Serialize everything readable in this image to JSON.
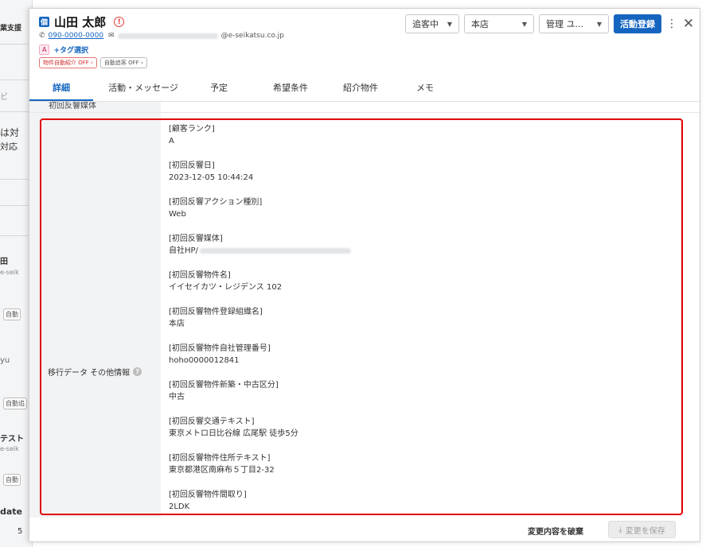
{
  "background": {
    "fragments": [
      "業支援",
      "ビ",
      "は対",
      "対応",
      "田",
      "e-seik",
      "自動",
      "yu",
      "自動追",
      "テスト",
      "e-seik",
      "自動",
      "date",
      "5"
    ]
  },
  "customer": {
    "name_badge": "個",
    "name": "山田 太郎",
    "phone": "090-0000-0000",
    "email_domain": "@e-seikatsu.co.jp",
    "tag_rank": "A",
    "tag_add_label": "+タグ選択",
    "pill_auto_intro": "物件自動紹介 OFF",
    "pill_auto_follow": "自動追客 OFF"
  },
  "header": {
    "status_value": "追客中",
    "branch_value": "本店",
    "manager_value": "管理 ユ...",
    "activity_button": "活動登録"
  },
  "tabs": [
    {
      "label": "詳細",
      "active": true
    },
    {
      "label": "活動・メッセージ",
      "active": false
    },
    {
      "label": "予定",
      "active": false
    },
    {
      "label": "希望条件",
      "active": false
    },
    {
      "label": "紹介物件",
      "active": false
    },
    {
      "label": "メモ",
      "active": false
    }
  ],
  "detail": {
    "previous_field_label": "初回反響媒体",
    "field_label": "移行データ その他情報",
    "items": [
      {
        "key": "[顧客ランク]",
        "value": "A"
      },
      {
        "key": "[初回反響日]",
        "value": "2023-12-05 10:44:24"
      },
      {
        "key": "[初回反響アクション種別]",
        "value": "Web"
      },
      {
        "key": "[初回反響媒体]",
        "value": "自社HP/"
      },
      {
        "key": "[初回反響物件名]",
        "value": "イイセイカツ・レジデンス 102"
      },
      {
        "key": "[初回反響物件登録組織名]",
        "value": "本店"
      },
      {
        "key": "[初回反響物件自社管理番号]",
        "value": "hoho0000012841"
      },
      {
        "key": "[初回反響物件新築・中古区分]",
        "value": "中古"
      },
      {
        "key": "[初回反響交通テキスト]",
        "value": "東京メトロ日比谷線 広尾駅 徒歩5分"
      },
      {
        "key": "[初回反響物件住所テキスト]",
        "value": "東京都港区南麻布５丁目2-32"
      },
      {
        "key": "[初回反響物件間取り]",
        "value": "2LDK"
      }
    ]
  },
  "footer": {
    "discard_label": "変更内容を破棄",
    "save_label": "変更を保存"
  },
  "colors": {
    "primary": "#1565c0",
    "highlight": "#e00000",
    "warning": "#e53935"
  }
}
